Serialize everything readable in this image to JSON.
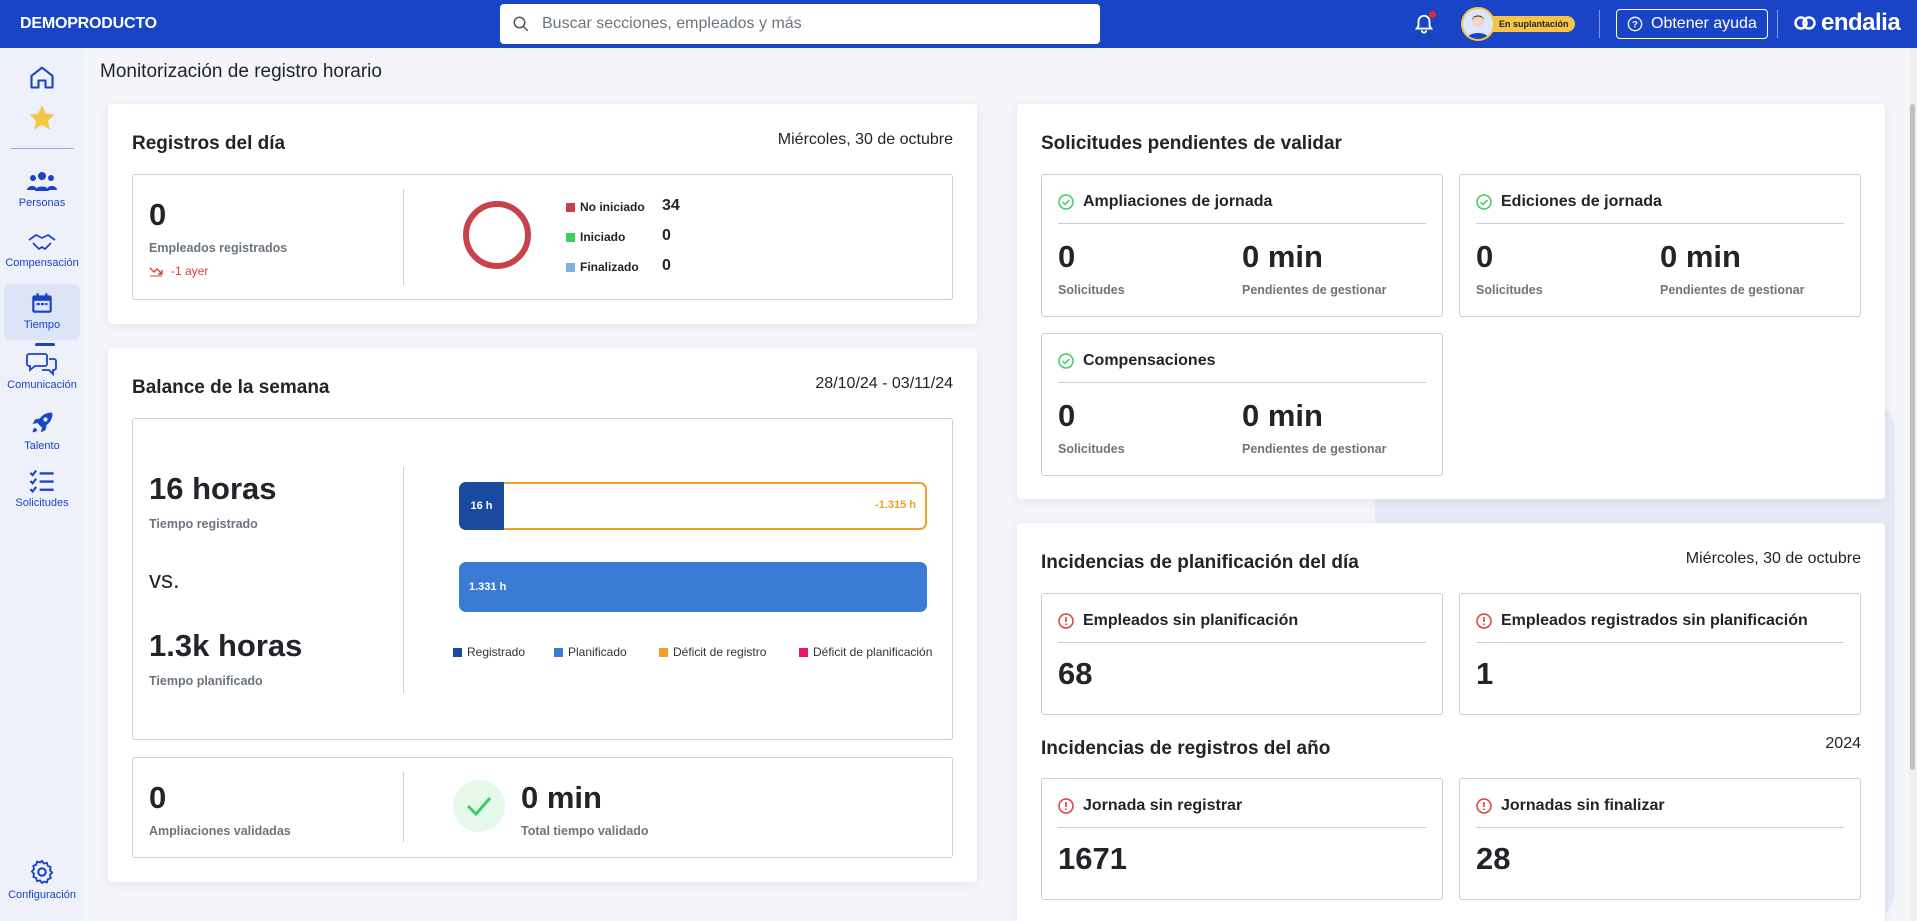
{
  "topbar": {
    "company": "DEMOPRODUCTO",
    "search_placeholder": "Buscar secciones, empleados y más",
    "impersonation_badge": "En suplantación",
    "help_label": "Obtener ayuda",
    "brand_logo": "endalia"
  },
  "sidebar": {
    "items": [
      {
        "icon": "home-icon",
        "label": ""
      },
      {
        "icon": "star-icon",
        "label": ""
      },
      {
        "icon": "people-icon",
        "label": "Personas"
      },
      {
        "icon": "handshake-icon",
        "label": "Compensación"
      },
      {
        "icon": "calendar-icon",
        "label": "Tiempo"
      },
      {
        "icon": "chat-icon",
        "label": "Comunicación"
      },
      {
        "icon": "rocket-icon",
        "label": "Talento"
      },
      {
        "icon": "checklist-icon",
        "label": "Solicitudes"
      },
      {
        "icon": "gear-icon",
        "label": "Configuración"
      }
    ],
    "active": "Tiempo"
  },
  "page": {
    "title": "Monitorización de registro horario"
  },
  "registros": {
    "title": "Registros del día",
    "date": "Miércoles, 30 de octubre",
    "registered_count": "0",
    "registered_label": "Empleados registrados",
    "trend": "-1 ayer",
    "donut": {
      "legend": [
        {
          "label": "No iniciado",
          "value": "34",
          "color": "#c8414b"
        },
        {
          "label": "Iniciado",
          "value": "0",
          "color": "#3ccf5c"
        },
        {
          "label": "Finalizado",
          "value": "0",
          "color": "#7fb0e4"
        }
      ]
    }
  },
  "balance": {
    "title": "Balance de la semana",
    "range": "28/10/24 - 03/11/24",
    "registered_value": "16 horas",
    "registered_label": "Tiempo registrado",
    "vs": "vs.",
    "planned_value": "1.3k horas",
    "planned_label": "Tiempo planificado",
    "bar_registered_label": "16 h",
    "bar_deficit_label": "-1.315 h",
    "bar_planned_label": "1.331 h",
    "registered_hours": 16,
    "planned_hours": 1331,
    "legend": [
      {
        "label": "Registrado",
        "color": "#1a4aa0"
      },
      {
        "label": "Planificado",
        "color": "#3a7bd5"
      },
      {
        "label": "Déficit de registro",
        "color": "#f0a02a"
      },
      {
        "label": "Déficit de planificación",
        "color": "#e6196a"
      }
    ],
    "ampliaciones_value": "0",
    "ampliaciones_label": "Ampliaciones validadas",
    "total_value": "0 min",
    "total_label": "Total tiempo validado"
  },
  "solicitudes": {
    "title": "Solicitudes pendientes de validar",
    "cards": [
      {
        "title": "Ampliaciones de jornada",
        "count": "0",
        "count_label": "Solicitudes",
        "pending": "0 min",
        "pending_label": "Pendientes de gestionar"
      },
      {
        "title": "Ediciones de jornada",
        "count": "0",
        "count_label": "Solicitudes",
        "pending": "0 min",
        "pending_label": "Pendientes de gestionar"
      },
      {
        "title": "Compensaciones",
        "count": "0",
        "count_label": "Solicitudes",
        "pending": "0 min",
        "pending_label": "Pendientes de gestionar"
      }
    ]
  },
  "incidencias_plan": {
    "title": "Incidencias de planificación del día",
    "date": "Miércoles, 30 de octubre",
    "cards": [
      {
        "title": "Empleados sin planificación",
        "value": "68"
      },
      {
        "title": "Empleados registrados sin planificación",
        "value": "1"
      }
    ]
  },
  "incidencias_reg": {
    "title": "Incidencias de registros del año",
    "year": "2024",
    "cards": [
      {
        "title": "Jornada sin registrar",
        "value": "1671"
      },
      {
        "title": "Jornadas sin finalizar",
        "value": "28"
      }
    ]
  },
  "colors": {
    "primary": "#1a44c6",
    "success": "#3ccf5c",
    "danger": "#e23b3b",
    "warning": "#f0a02a"
  }
}
